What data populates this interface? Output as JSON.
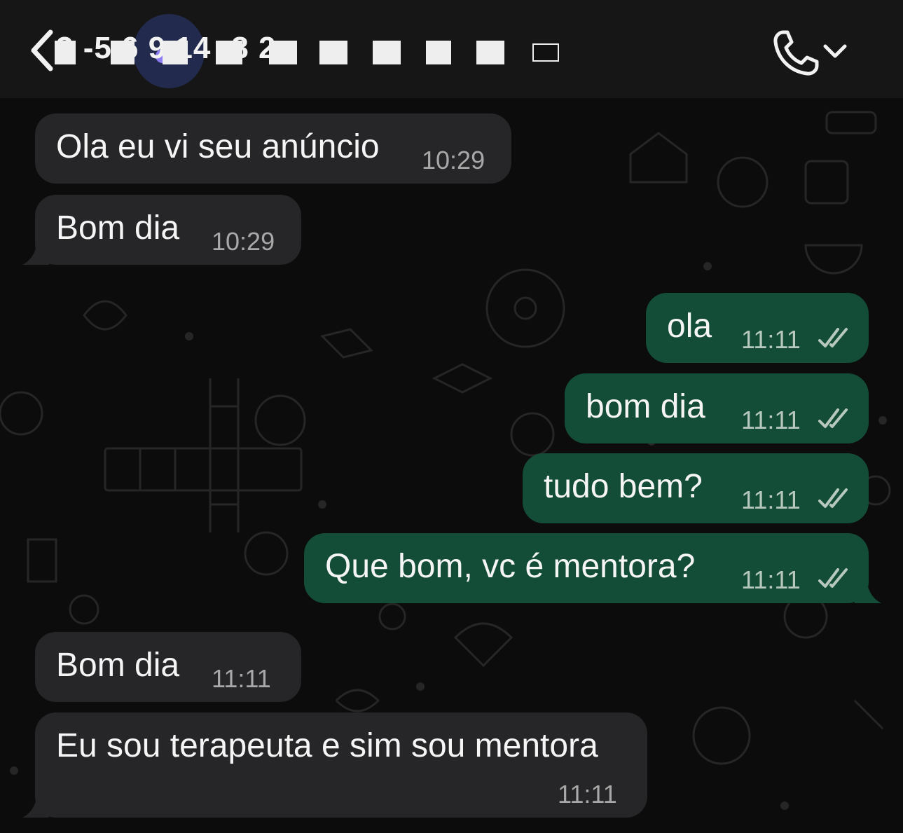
{
  "header": {
    "contact_name": "3  -5 6 9 14 -8 2",
    "back_icon": "chevron-left-icon",
    "call_icon": "phone-icon",
    "call_menu_icon": "chevron-down-icon"
  },
  "colors": {
    "incoming_bubble": "#262628",
    "outgoing_bubble": "#144d37",
    "background": "#0c0c0c",
    "header": "#161616",
    "read_ticks": "#b7c9bf"
  },
  "messages": [
    {
      "direction": "incoming",
      "text": "Ola eu vi seu anúncio",
      "time": "10:29"
    },
    {
      "direction": "incoming",
      "text": "Bom dia",
      "time": "10:29"
    },
    {
      "direction": "outgoing",
      "text": "ola",
      "time": "11:11",
      "status": "read"
    },
    {
      "direction": "outgoing",
      "text": "bom dia",
      "time": "11:11",
      "status": "read"
    },
    {
      "direction": "outgoing",
      "text": "tudo bem?",
      "time": "11:11",
      "status": "read"
    },
    {
      "direction": "outgoing",
      "text": "Que bom, vc é mentora?",
      "time": "11:11",
      "status": "read"
    },
    {
      "direction": "incoming",
      "text": "Bom dia",
      "time": "11:11"
    },
    {
      "direction": "incoming",
      "text": "Eu sou terapeuta e sim sou mentora",
      "time": "11:11"
    }
  ]
}
